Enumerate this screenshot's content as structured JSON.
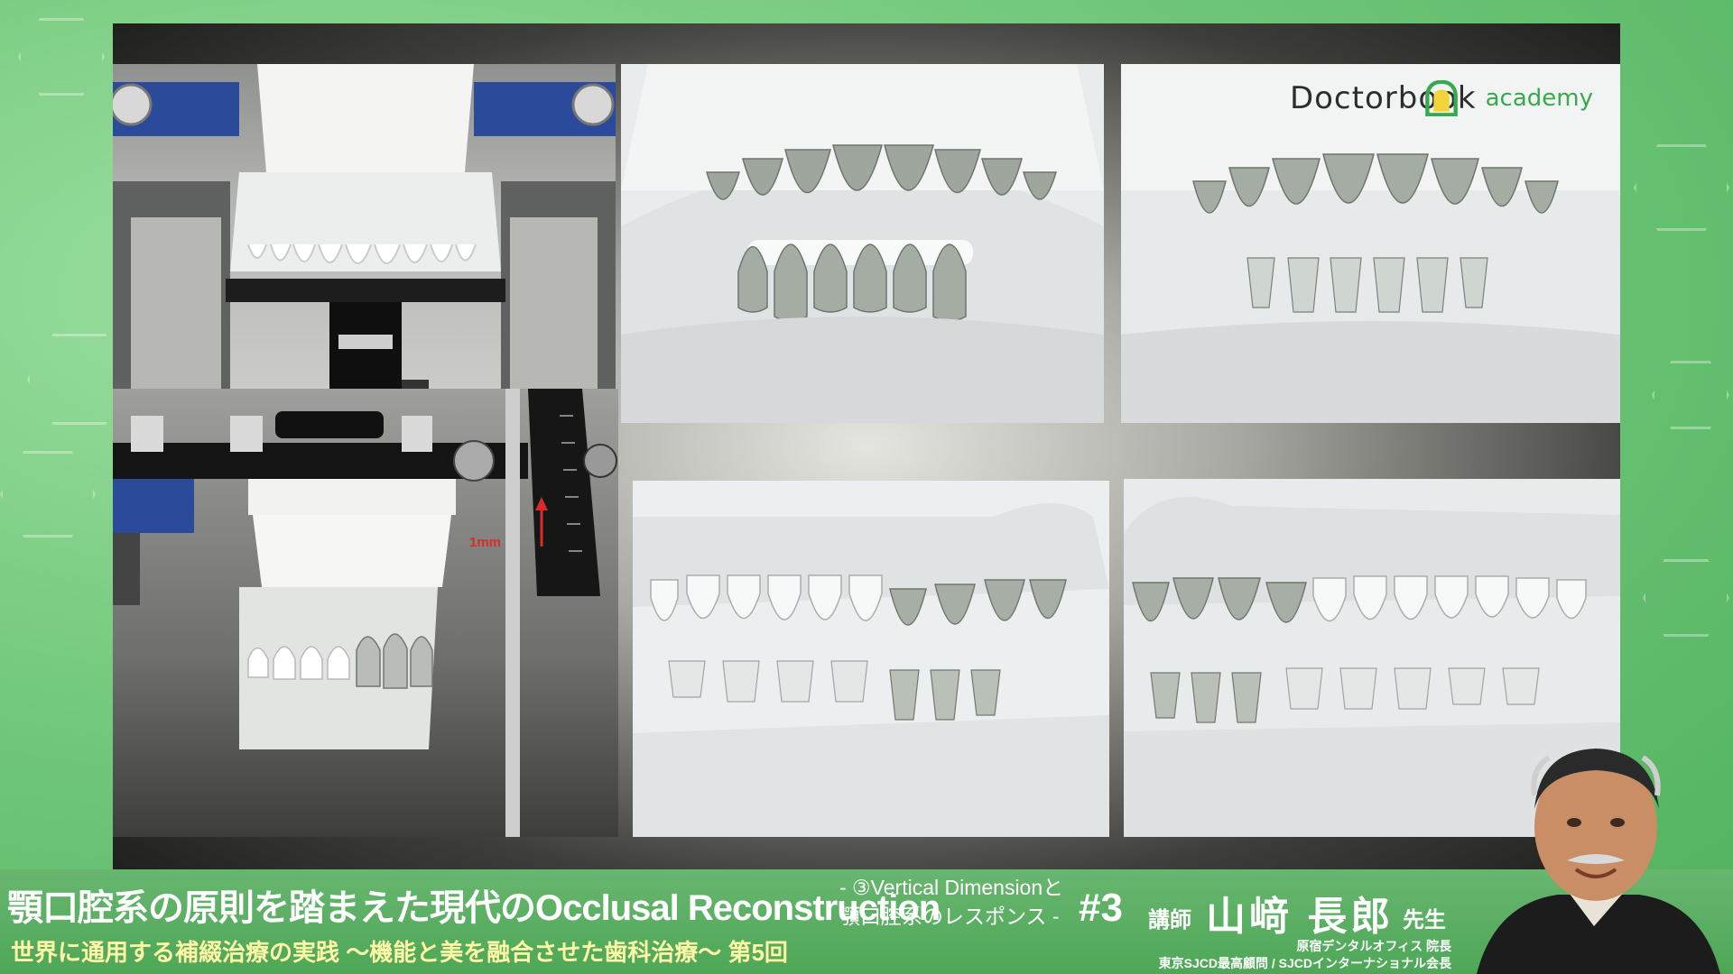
{
  "logo": {
    "brand": "Doctorbook",
    "sub": "academy",
    "accent_color": "#39a94d",
    "icon": "shield-pin-icon"
  },
  "slide": {
    "annotation": "1mm",
    "annotation_color": "#d92b2b",
    "photos": [
      {
        "name": "articulator-front-photo"
      },
      {
        "name": "cast-frontal-open-photo"
      },
      {
        "name": "cast-frontal-closed-photo"
      },
      {
        "name": "articulator-side-photo"
      },
      {
        "name": "cast-right-lateral-photo"
      },
      {
        "name": "cast-left-lateral-photo"
      }
    ]
  },
  "titlebar": {
    "main_title": "顎口腔系の原則を踏まえた現代のOcclusal Reconstruction",
    "subtitle": "世界に通用する補綴治療の実践 ～機能と美を融合させた歯科治療～ 第5回",
    "chapter_line1": "- ③Vertical Dimensionと",
    "chapter_line2": "顎口腔系のレスポンス -",
    "episode": "#3",
    "lecturer_label": "講師",
    "lecturer_name": "山﨑 長郎",
    "honorific": "先生",
    "affiliation1": "原宿デンタルオフィス 院長",
    "affiliation2": "東京SJCD最高顧問 / SJCDインターナショナル会長",
    "subtitle_color": "#fff6a6",
    "bar_color": "#55aa5e"
  }
}
